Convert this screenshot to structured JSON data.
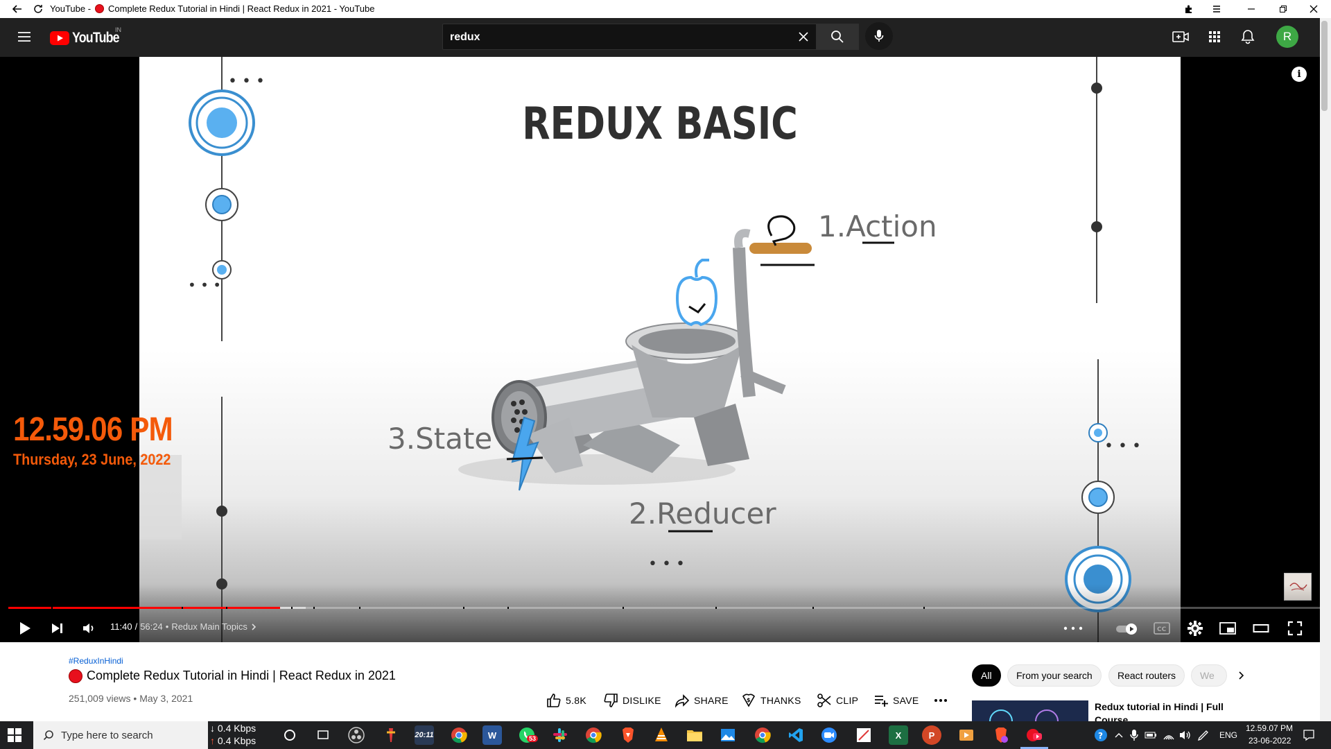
{
  "window": {
    "tab_prefix": "YouTube -",
    "title": "Complete Redux Tutorial in Hindi | React Redux in 2021 - YouTube"
  },
  "header": {
    "logo_text": "YouTube",
    "country_code": "IN",
    "search_value": "redux",
    "avatar_letter": "R"
  },
  "slide": {
    "title": "REDUX BASIC",
    "step_action": "1.Action",
    "step_reducer": "2.Reducer",
    "step_state": "3.State"
  },
  "clock_overlay": {
    "time": "12.59.06 PM",
    "date": "Thursday, 23 June, 2022"
  },
  "player": {
    "current_time": "11:40",
    "separator": "/",
    "duration": "56:24",
    "chapter": "Redux Main Topics",
    "progress_fraction": 0.207,
    "buffered_fraction": 0.227
  },
  "video": {
    "hashtag": "#ReduxInHindi",
    "title": "Complete Redux Tutorial in Hindi | React Redux in 2021",
    "views": "251,009 views",
    "date": "May 3, 2021",
    "likes": "5.8K",
    "dislike_label": "DISLIKE",
    "share_label": "SHARE",
    "thanks_label": "THANKS",
    "clip_label": "CLIP",
    "save_label": "SAVE"
  },
  "chips": [
    "All",
    "From your search",
    "React routers",
    "We"
  ],
  "recommendation": {
    "title": "Redux tutorial in Hindi | Full Course"
  },
  "taskbar": {
    "search_placeholder": "Type here to search",
    "net_down": "0.4 Kbps",
    "net_up": "0.4 Kbps",
    "whatsapp_badge": "53",
    "language": "ENG",
    "time": "12.59.07 PM",
    "date": "23-06-2022",
    "app_2011": "20:11"
  },
  "colors": {
    "accent_red": "#ff0000",
    "clock_orange": "#f45a0a",
    "header_bg": "#212121",
    "avatar_green": "#3ea845",
    "slide_circle_blue": "#5ab0f0"
  }
}
